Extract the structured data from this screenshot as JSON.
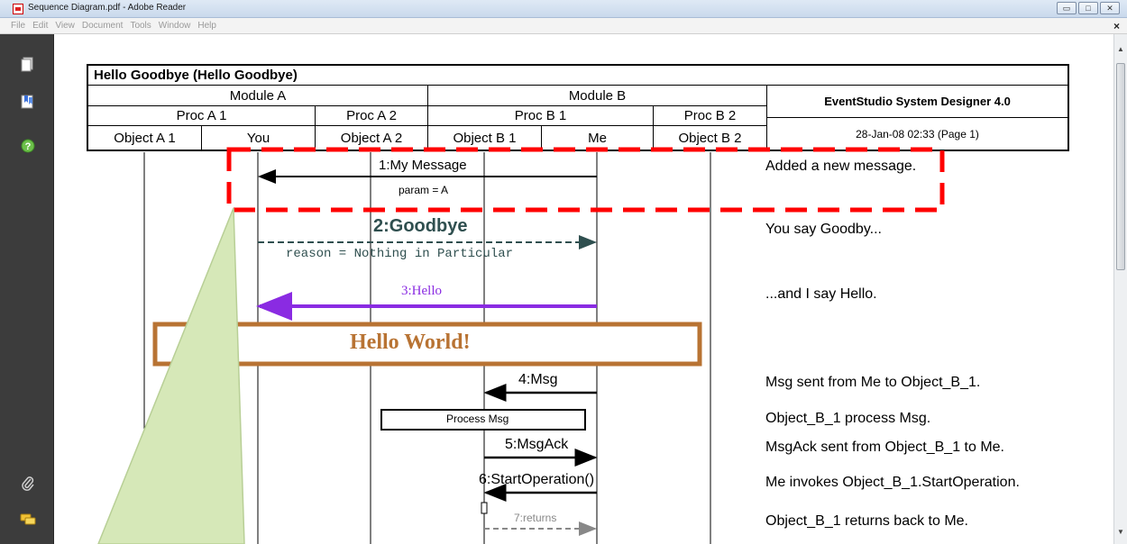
{
  "window": {
    "title": "Sequence Diagram.pdf - Adobe Reader",
    "buttons": {
      "minimize": "▭",
      "maximize": "□",
      "close": "✕"
    }
  },
  "menu": {
    "items": [
      "File",
      "Edit",
      "View",
      "Document",
      "Tools",
      "Window",
      "Help"
    ],
    "close_glyph": "×"
  },
  "nav_icons": [
    "pages-icon",
    "bookmarks-icon",
    "help-icon",
    "attachments-icon",
    "comments-icon"
  ],
  "diagram": {
    "title": "Hello Goodbye (Hello Goodbye)",
    "modules": [
      "Module A",
      "Module B"
    ],
    "procs": [
      "Proc A 1",
      "Proc A 2",
      "Proc B 1",
      "Proc B 2"
    ],
    "objects": [
      "Object A 1",
      "You",
      "Object A 2",
      "Object B 1",
      "Me",
      "Object B 2"
    ],
    "tool": "EventStudio System Designer 4.0",
    "date": "28-Jan-08 02:33 (Page 1)",
    "messages": {
      "m1": "1:My Message",
      "m1_param": "param = A",
      "m2": "2:Goodbye",
      "m2_param": "reason = Nothing in Particular",
      "m3": "3:Hello",
      "hello_world": "Hello World!",
      "m4": "4:Msg",
      "action": "Process Msg",
      "m5": "5:MsgAck",
      "m6": "6:StartOperation()",
      "m7": "7:returns"
    },
    "notes": {
      "n1": "Added a new message.",
      "n2": "You say Goodby...",
      "n3": "...and I say Hello.",
      "n4": "Msg sent from Me to Object_B_1.",
      "n5": "Object_B_1 process Msg.",
      "n6": "MsgAck sent from Object_B_1 to Me.",
      "n7": "Me invokes Object_B_1.StartOperation.",
      "n8": "Object_B_1 returns back to Me."
    }
  },
  "colors": {
    "goodbye": "#2f4f4f",
    "hello": "#8a2be2",
    "hello_world": "#b87333",
    "highlight": "#ff0000",
    "callout": "#d6e8b8"
  }
}
